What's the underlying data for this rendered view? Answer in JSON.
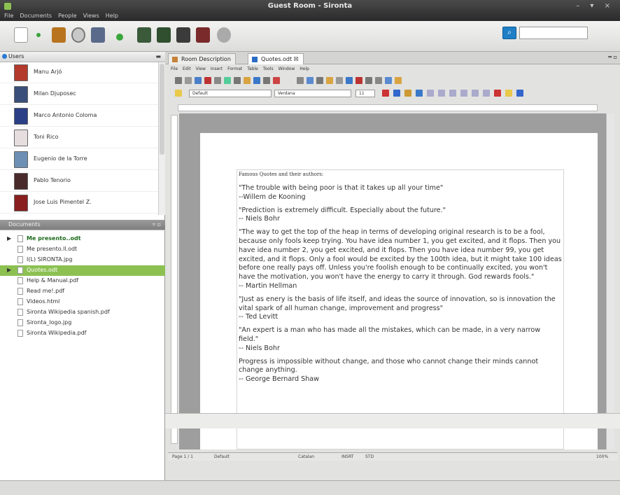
{
  "window": {
    "title": "Guest Room - Sironta",
    "controls": "–  ▾  ×"
  },
  "menu": [
    "File",
    "Documents",
    "People",
    "Views",
    "Help"
  ],
  "toolbar": {
    "search_icon": "magnifier-icon",
    "search_value": ""
  },
  "users_panel": {
    "title": "Users",
    "users": [
      {
        "name": "Manu Arjó",
        "color": "#b33a2c"
      },
      {
        "name": "Milan Djuposec",
        "color": "#3a4f7a"
      },
      {
        "name": "Marco Antonio Coloma",
        "color": "#2a3f85"
      },
      {
        "name": "Toni Rico",
        "color": "#e6dede"
      },
      {
        "name": "Eugenio de la Torre",
        "color": "#6c8fb3"
      },
      {
        "name": "Pablo Tenorio",
        "color": "#4a2b2b"
      },
      {
        "name": "Jose Luis Pimentel Z.",
        "color": "#8a1f1f"
      }
    ]
  },
  "documents_panel": {
    "title": "Documents",
    "docs": [
      {
        "name": "Me presento..odt",
        "bold": true,
        "arrow": "▶",
        "selected": false
      },
      {
        "name": "Me presento.ll.odt",
        "bold": false,
        "arrow": "",
        "selected": false
      },
      {
        "name": "I(L) SIRONTA.jpg",
        "bold": false,
        "arrow": "",
        "selected": false
      },
      {
        "name": "Quotes.odt",
        "bold": false,
        "arrow": "▶",
        "selected": true
      },
      {
        "name": "Help & Manual.pdf",
        "bold": false,
        "arrow": "",
        "selected": false
      },
      {
        "name": "Read me!.pdf",
        "bold": false,
        "arrow": "",
        "selected": false
      },
      {
        "name": "Videos.html",
        "bold": false,
        "arrow": "",
        "selected": false
      },
      {
        "name": "Sironta Wikipedia spanish.pdf",
        "bold": false,
        "arrow": "",
        "selected": false
      },
      {
        "name": "Sironta_logo.jpg",
        "bold": false,
        "arrow": "",
        "selected": false
      },
      {
        "name": "Sironta Wikipedia.pdf",
        "bold": false,
        "arrow": "",
        "selected": false
      }
    ]
  },
  "tabs": [
    {
      "label": "Room Description",
      "active": false
    },
    {
      "label": "Quotes.odt ☒",
      "active": true
    }
  ],
  "editor": {
    "menu": [
      "File",
      "Edit",
      "View",
      "Insert",
      "Format",
      "Table",
      "Tools",
      "Window",
      "Help"
    ],
    "style": "Default",
    "font": "Verdana",
    "size": "11",
    "heading": "Famous Quotes and their authors:",
    "quotes": [
      {
        "text": "\"The trouble with being poor is that it takes up all your time\"",
        "author": "--Willem de Kooning"
      },
      {
        "text": "\"Prediction is extremely difficult. Especially about the future.\"",
        "author": "-- Niels Bohr"
      },
      {
        "text": "\"The way to get the top of the heap in terms of developing original research is to be a fool, because only fools keep trying. You have idea number 1, you get excited, and it flops. Then you have idea number 2, you get excited, and it flops. Then you have idea number 99, you get excited, and it flops. Only a fool would be excited by the 100th idea, but it might take 100 ideas before one really pays off. Unless you're foolish enough to be continually excited, you won't have the motivation, you won't have the energy to carry it through. God rewards fools.\"",
        "author": "-- Martin Hellman"
      },
      {
        "text": "\"Just as enery is the basis of life itself, and ideas the source of innovation, so is innovation the vital spark of all human change, improvement and progress\"",
        "author": "-- Ted Levitt"
      },
      {
        "text": "\"An expert is a man who has made all the mistakes, which can be made, in a very narrow field.\"",
        "author": "-- Niels Bohr"
      },
      {
        "text": "Progress is impossible without change, and those who cannot change their minds cannot change anything.",
        "author": "-- George Bernard Shaw"
      }
    ]
  },
  "status": {
    "page": "Page 1 / 1",
    "style": "Default",
    "lang": "Catalan",
    "mode": "INSRT",
    "sel": "STD",
    "zoom": "100%"
  }
}
